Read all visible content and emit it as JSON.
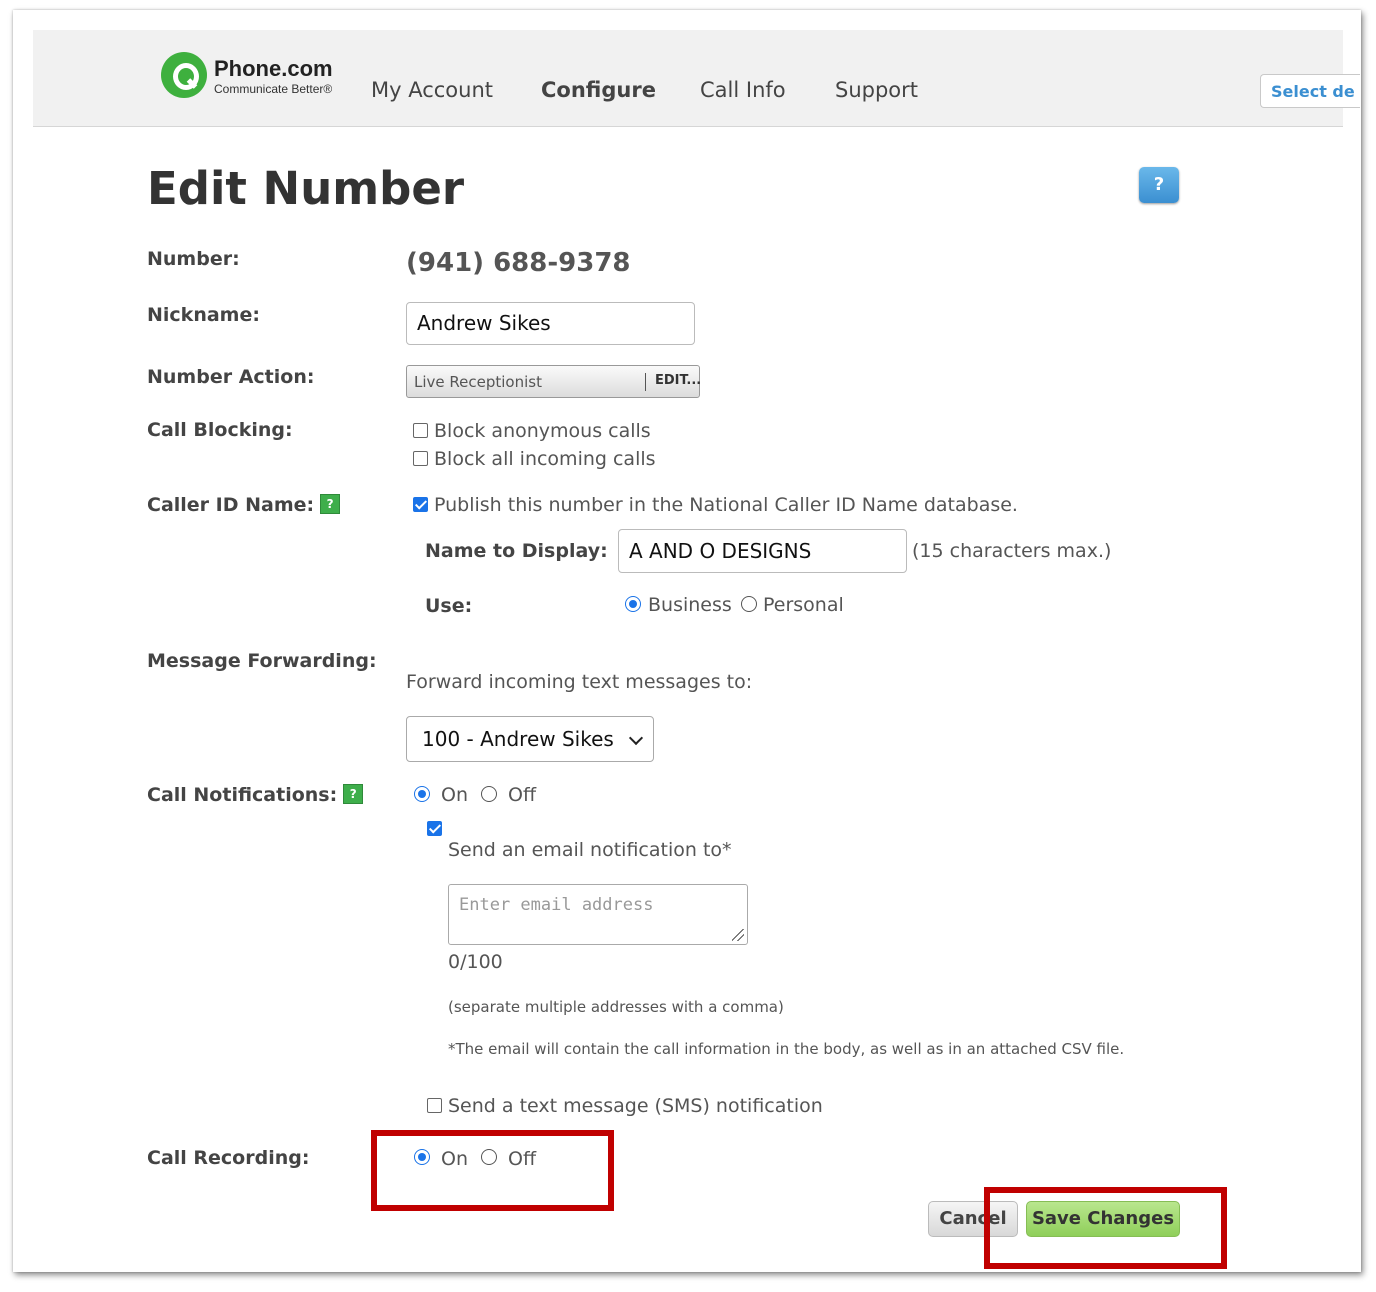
{
  "header": {
    "brand_name": "Phone.com",
    "brand_tagline": "Communicate Better®",
    "nav": [
      "My Account",
      "Configure",
      "Call Info",
      "Support"
    ],
    "select_label": "Select de"
  },
  "page": {
    "title": "Edit Number",
    "help_label": "?"
  },
  "form": {
    "number": {
      "label": "Number:",
      "value": "(941) 688-9378"
    },
    "nickname": {
      "label": "Nickname:",
      "value": "Andrew Sikes"
    },
    "number_action": {
      "label": "Number Action:",
      "value": "Live Receptionist",
      "edit_label": "EDIT..."
    },
    "call_blocking": {
      "label": "Call Blocking:",
      "opt_anonymous": "Block anonymous calls",
      "opt_all": "Block all incoming calls"
    },
    "caller_id": {
      "label": "Caller ID Name:",
      "publish": "Publish this number in the National Caller ID Name database.",
      "name_label": "Name to Display:",
      "name_value": "A AND O DESIGNS",
      "name_hint": "(15 characters max.)",
      "use_label": "Use:",
      "use_business": "Business",
      "use_personal": "Personal"
    },
    "message_forwarding": {
      "label": "Message Forwarding:",
      "prompt": "Forward incoming text messages to:",
      "selected": "100 - Andrew Sikes"
    },
    "call_notifications": {
      "label": "Call Notifications:",
      "on": "On",
      "off": "Off",
      "email_label": "Send an email notification to*",
      "email_placeholder": "Enter email address",
      "counter": "0/100",
      "separator_hint": "(separate multiple addresses with a comma)",
      "csv_note": "*The email will contain the call information in the body, as well as in an attached CSV file.",
      "sms_label": "Send a text message (SMS) notification"
    },
    "call_recording": {
      "label": "Call Recording:",
      "on": "On",
      "off": "Off"
    }
  },
  "actions": {
    "cancel": "Cancel",
    "save": "Save Changes"
  },
  "colors": {
    "brand_green": "#3eb03e",
    "accent_blue": "#1a73e8",
    "highlight_red": "#c00000",
    "save_green": "#8fcf5a"
  }
}
